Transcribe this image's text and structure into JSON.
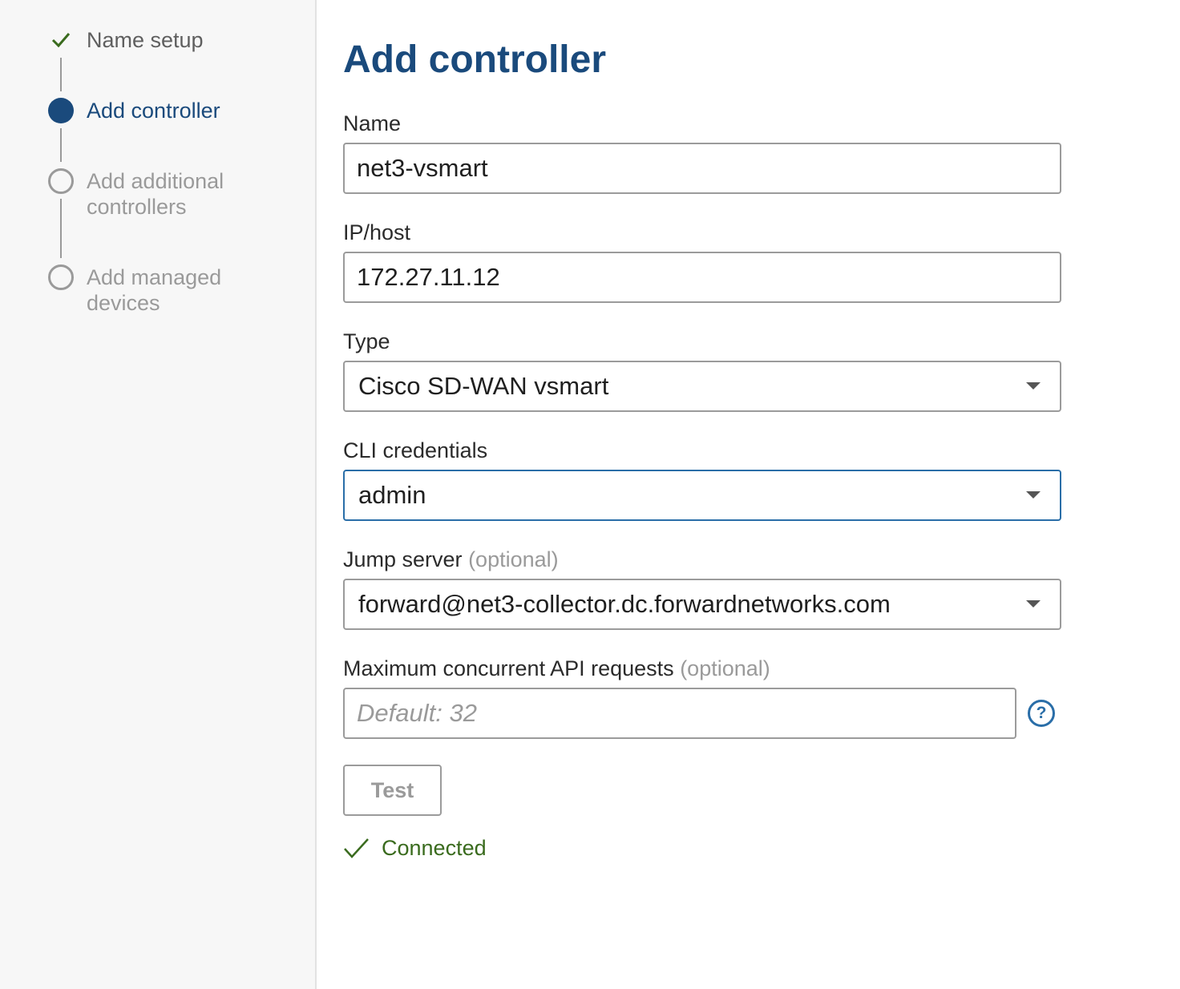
{
  "steps": [
    {
      "label": "Name setup",
      "state": "done"
    },
    {
      "label": "Add controller",
      "state": "active"
    },
    {
      "label": "Add additional controllers",
      "state": "pending"
    },
    {
      "label": "Add managed devices",
      "state": "pending"
    }
  ],
  "form": {
    "title": "Add controller",
    "name": {
      "label": "Name",
      "value": "net3-vsmart"
    },
    "ip_host": {
      "label": "IP/host",
      "value": "172.27.11.12"
    },
    "type": {
      "label": "Type",
      "value": "Cisco SD-WAN vsmart"
    },
    "cli_credentials": {
      "label": "CLI credentials",
      "value": "admin"
    },
    "jump_server": {
      "label": "Jump server",
      "optional": "(optional)",
      "value": "forward@net3-collector.dc.forwardnetworks.com"
    },
    "max_api": {
      "label": "Maximum concurrent API requests",
      "optional": "(optional)",
      "placeholder": "Default: 32",
      "help_icon": "?"
    },
    "test_button": "Test",
    "status": "Connected"
  },
  "colors": {
    "accent": "#1a4a7c",
    "focus": "#2a6ea8",
    "success": "#3a6b1e",
    "muted": "#9a9a9a"
  },
  "icons": {
    "step_done": "check-icon",
    "status": "check-icon",
    "select": "caret-down-icon",
    "help": "help-circle-icon"
  }
}
